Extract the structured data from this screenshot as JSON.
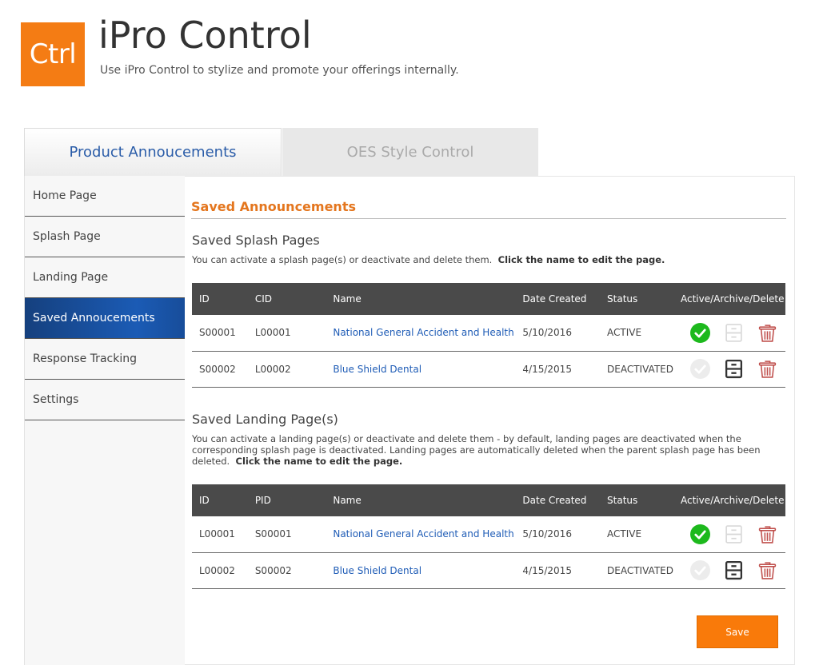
{
  "header": {
    "logo_text": "Ctrl",
    "title": "iPro Control",
    "subtitle": "Use iPro Control to stylize and promote your offerings internally."
  },
  "tabs": [
    {
      "label": "Product Annoucements",
      "active": true
    },
    {
      "label": "OES Style Control",
      "active": false
    }
  ],
  "sidebar": {
    "items": [
      {
        "label": "Home Page"
      },
      {
        "label": "Splash Page"
      },
      {
        "label": "Landing Page"
      },
      {
        "label": "Saved Annoucements",
        "active": true
      },
      {
        "label": "Response Tracking"
      },
      {
        "label": "Settings"
      }
    ]
  },
  "main": {
    "section_title": "Saved Announcements",
    "splash": {
      "heading": "Saved Splash Pages",
      "desc": "You can activate a splash page(s) or deactivate and delete them.",
      "desc_bold": "Click the name to edit the page.",
      "columns": [
        "ID",
        "CID",
        "Name",
        "Date Created",
        "Status",
        "Active/Archive/Delete"
      ],
      "rows": [
        {
          "id": "S00001",
          "ref": "L00001",
          "name": "National General Accident and Health",
          "date": "5/10/2016",
          "status": "ACTIVE"
        },
        {
          "id": "S00002",
          "ref": "L00002",
          "name": "Blue Shield Dental",
          "date": "4/15/2015",
          "status": "DEACTIVATED"
        }
      ]
    },
    "landing": {
      "heading": "Saved Landing Page(s)",
      "desc": "You can activate a landing page(s) or deactivate and delete them - by default, landing pages are deactivated when the corresponding splash page is deactivated.  Landing pages are automatically deleted when the parent splash page has been deleted.",
      "desc_bold": "Click the name to edit the page.",
      "columns": [
        "ID",
        "PID",
        "Name",
        "Date Created",
        "Status",
        "Active/Archive/Delete"
      ],
      "rows": [
        {
          "id": "L00001",
          "ref": "S00001",
          "name": "National General Accident and Health",
          "date": "5/10/2016",
          "status": "ACTIVE"
        },
        {
          "id": "L00002",
          "ref": "S00002",
          "name": "Blue Shield Dental",
          "date": "4/15/2015",
          "status": "DEACTIVATED"
        }
      ]
    },
    "save_label": "Save"
  },
  "icons": {
    "active": "check-circle-icon",
    "archive": "archive-drawer-icon",
    "delete": "trash-icon"
  },
  "colors": {
    "brand_orange": "#f47c14",
    "link_blue": "#1f5cb6",
    "active_green": "#1db91d",
    "delete_red": "#c0504d"
  }
}
